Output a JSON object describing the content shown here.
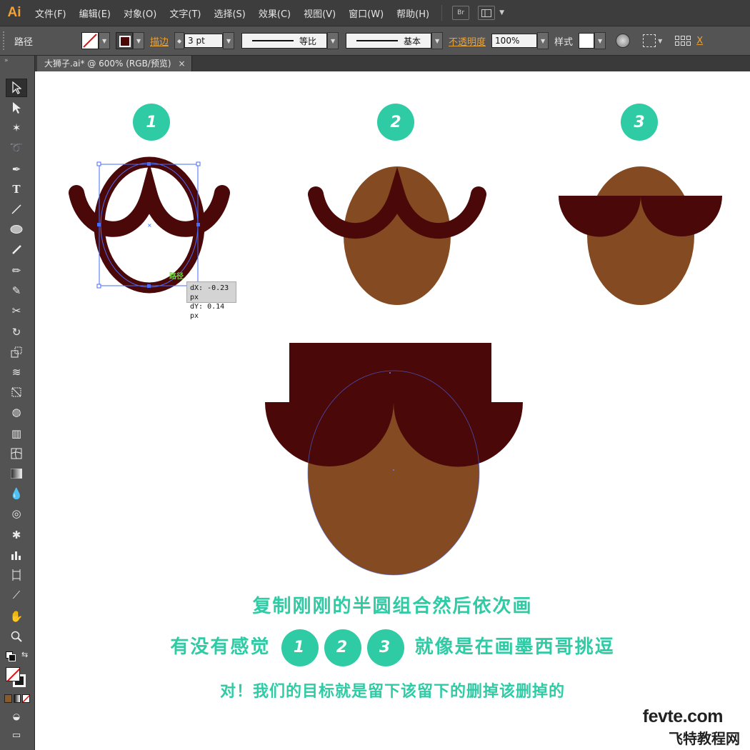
{
  "app": {
    "logo": "Ai"
  },
  "menu": [
    "文件(F)",
    "编辑(E)",
    "对象(O)",
    "文字(T)",
    "选择(S)",
    "效果(C)",
    "视图(V)",
    "窗口(W)",
    "帮助(H)"
  ],
  "menu_buttons": {
    "bridge": "Br"
  },
  "control": {
    "selection_label": "路径",
    "stroke_label": "描边",
    "stroke_weight": "3 pt",
    "profile1": "等比",
    "profile2": "基本",
    "opacity_label": "不透明度",
    "opacity_value": "100%",
    "style_label": "样式",
    "x_label": "X"
  },
  "document": {
    "tab_title": "大狮子.ai* @ 600% (RGB/预览)",
    "close": "×"
  },
  "canvas": {
    "steps": [
      "1",
      "2",
      "3"
    ],
    "tooltip": {
      "dx": "dX: -0.23 px",
      "dy": "dY: 0.14 px"
    },
    "path_hint": "路径",
    "caption1": "复制刚刚的半圆组合然后依次画",
    "caption2_prefix": "有没有感觉",
    "caption2_suffix": "就像是在画墨西哥挑逗",
    "caption3": "对！我们的目标就是留下该留下的删掉该删掉的",
    "watermark1": "fevte.com",
    "watermark2": "飞特教程网"
  },
  "colors": {
    "face": "#844a21",
    "hat": "#4a0808",
    "accent": "#2ecba4",
    "selection": "#4a6cf7"
  }
}
